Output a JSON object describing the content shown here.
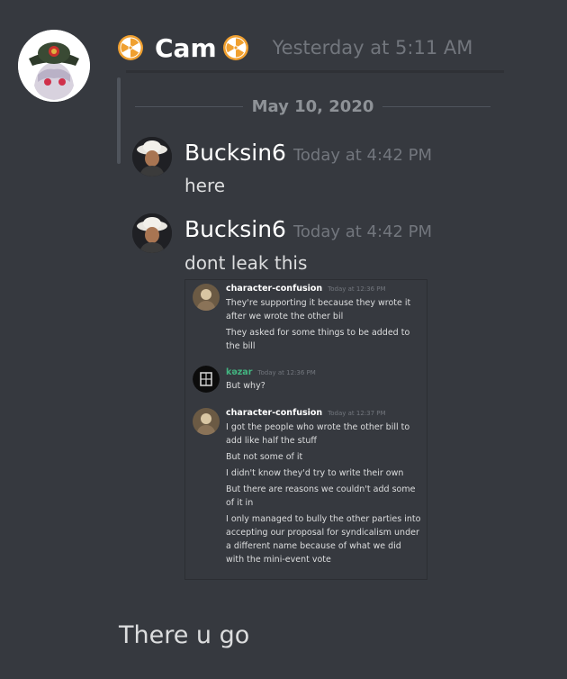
{
  "message": {
    "author": "Cam",
    "timestamp": "Yesterday at 5:11 AM",
    "text": "There u go"
  },
  "embed": {
    "date_divider": "May 10, 2020",
    "messages": [
      {
        "author": "Bucksin6",
        "time": "Today at 4:42 PM",
        "text": "here"
      },
      {
        "author": "Bucksin6",
        "time": "Today at 4:42 PM",
        "text": "dont leak this"
      }
    ]
  },
  "inner_screenshot": {
    "messages": [
      {
        "author": "character-confusion",
        "author_color": "#ffffff",
        "time": "Today at 12:36 PM",
        "lines": [
          "They're supporting it because they wrote it",
          "after we wrote the other bil",
          "They asked for some things to be added to",
          "the bill"
        ]
      },
      {
        "author": "kəzar",
        "author_color": "#43b581",
        "time": "Today at 12:36 PM",
        "lines": [
          "But why?"
        ]
      },
      {
        "author": "character-confusion",
        "author_color": "#ffffff",
        "time": "Today at 12:37 PM",
        "lines": [
          "I got the people who wrote the other bill to",
          "add like half the stuff",
          "But not some of it",
          "I didn't know they'd try to write their own",
          "But there are reasons we couldn't add some",
          "of it in",
          "I only managed to bully the other parties into",
          "accepting our proposal for syndicalism under",
          "a different name because of what we did",
          "with the mini-event vote"
        ]
      }
    ]
  },
  "colors": {
    "background": "#36393f",
    "radioactive_icon": "#f0a030",
    "muted_text": "#72767d"
  }
}
